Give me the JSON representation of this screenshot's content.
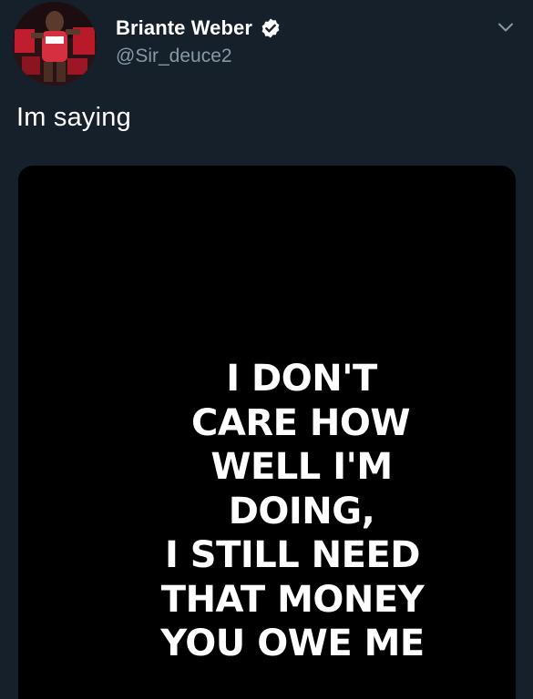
{
  "tweet": {
    "author": {
      "display_name": "Briante Weber",
      "handle": "@Sir_deuce2",
      "verified": true
    },
    "text": "Im saying",
    "media": {
      "lines": [
        "I DON'T",
        "CARE HOW",
        "WELL I'M",
        "DOING,",
        "I STILL NEED",
        "THAT MONEY",
        "YOU OWE ME"
      ]
    }
  },
  "colors": {
    "background": "#15202b",
    "name": "#ffffff",
    "handle": "#8899a6",
    "verified_badge": "#ffffff",
    "media_background": "#000000"
  },
  "icons": {
    "verified": "verified-badge-icon",
    "caret": "chevron-down-icon",
    "avatar": "profile-avatar"
  }
}
